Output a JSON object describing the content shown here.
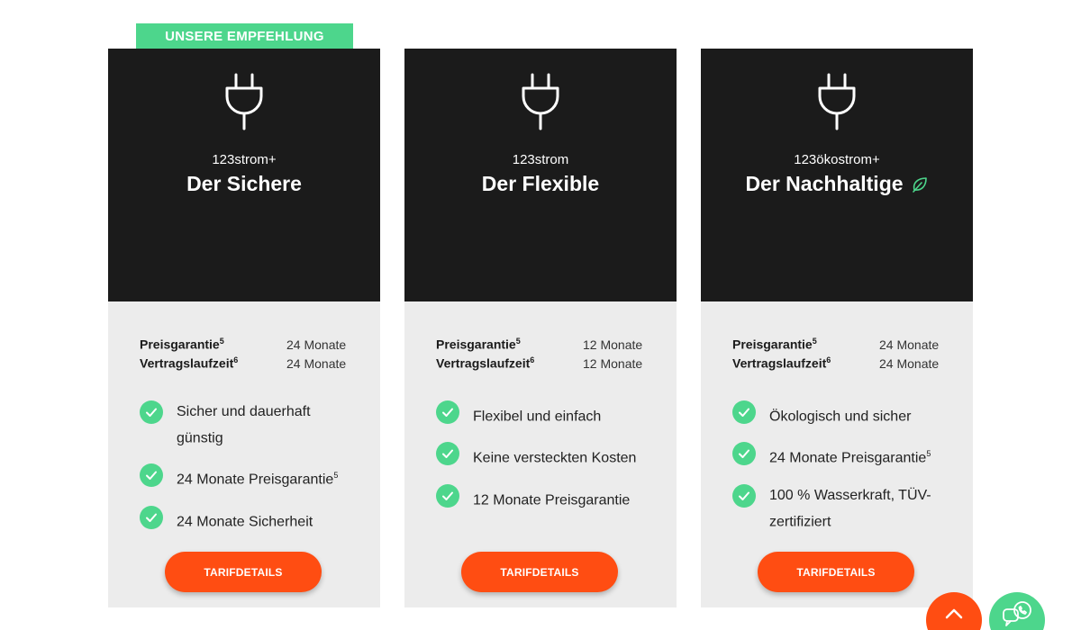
{
  "recommendation_badge": "UNSERE EMPFEHLUNG",
  "colors": {
    "accent_green": "#4dd68c",
    "cta_orange": "#ff4d12",
    "card_dark": "#1b1b1b",
    "card_light": "#ececec"
  },
  "cards": [
    {
      "product": "123strom+",
      "name": "Der Sichere",
      "eco_icon": false,
      "terms": [
        {
          "label": "Preisgarantie",
          "sup": "5",
          "value": "24 Monate"
        },
        {
          "label": "Vertragslaufzeit",
          "sup": "6",
          "value": "24 Monate"
        }
      ],
      "features": [
        {
          "text": "Sicher und dauerhaft günstig",
          "sup": ""
        },
        {
          "text": "24 Monate Preisgarantie",
          "sup": "5"
        },
        {
          "text": "24 Monate Sicherheit",
          "sup": ""
        }
      ],
      "button": "TARIFDETAILS"
    },
    {
      "product": "123strom",
      "name": "Der Flexible",
      "eco_icon": false,
      "terms": [
        {
          "label": "Preisgarantie",
          "sup": "5",
          "value": "12 Monate"
        },
        {
          "label": "Vertragslaufzeit",
          "sup": "6",
          "value": "12 Monate"
        }
      ],
      "features": [
        {
          "text": "Flexibel und einfach",
          "sup": ""
        },
        {
          "text": "Keine versteckten Kosten",
          "sup": ""
        },
        {
          "text": "12 Monate Preisgarantie",
          "sup": ""
        }
      ],
      "button": "TARIFDETAILS"
    },
    {
      "product": "123ökostrom+",
      "name": "Der Nachhaltige",
      "eco_icon": true,
      "terms": [
        {
          "label": "Preisgarantie",
          "sup": "5",
          "value": "24 Monate"
        },
        {
          "label": "Vertragslaufzeit",
          "sup": "6",
          "value": "24 Monate"
        }
      ],
      "features": [
        {
          "text": "Ökologisch und sicher",
          "sup": ""
        },
        {
          "text": "24 Monate Preisgarantie",
          "sup": "5"
        },
        {
          "text": "100 % Wasserkraft, TÜV-zertifiziert",
          "sup": ""
        }
      ],
      "button": "TARIFDETAILS"
    }
  ],
  "icons": {
    "tariff_icon": "plug-icon",
    "feature_icon": "check-circle-icon",
    "eco_icon": "leaf-icon",
    "scroll_top": "chevron-up-icon",
    "contact": "chat-phone-icon"
  }
}
